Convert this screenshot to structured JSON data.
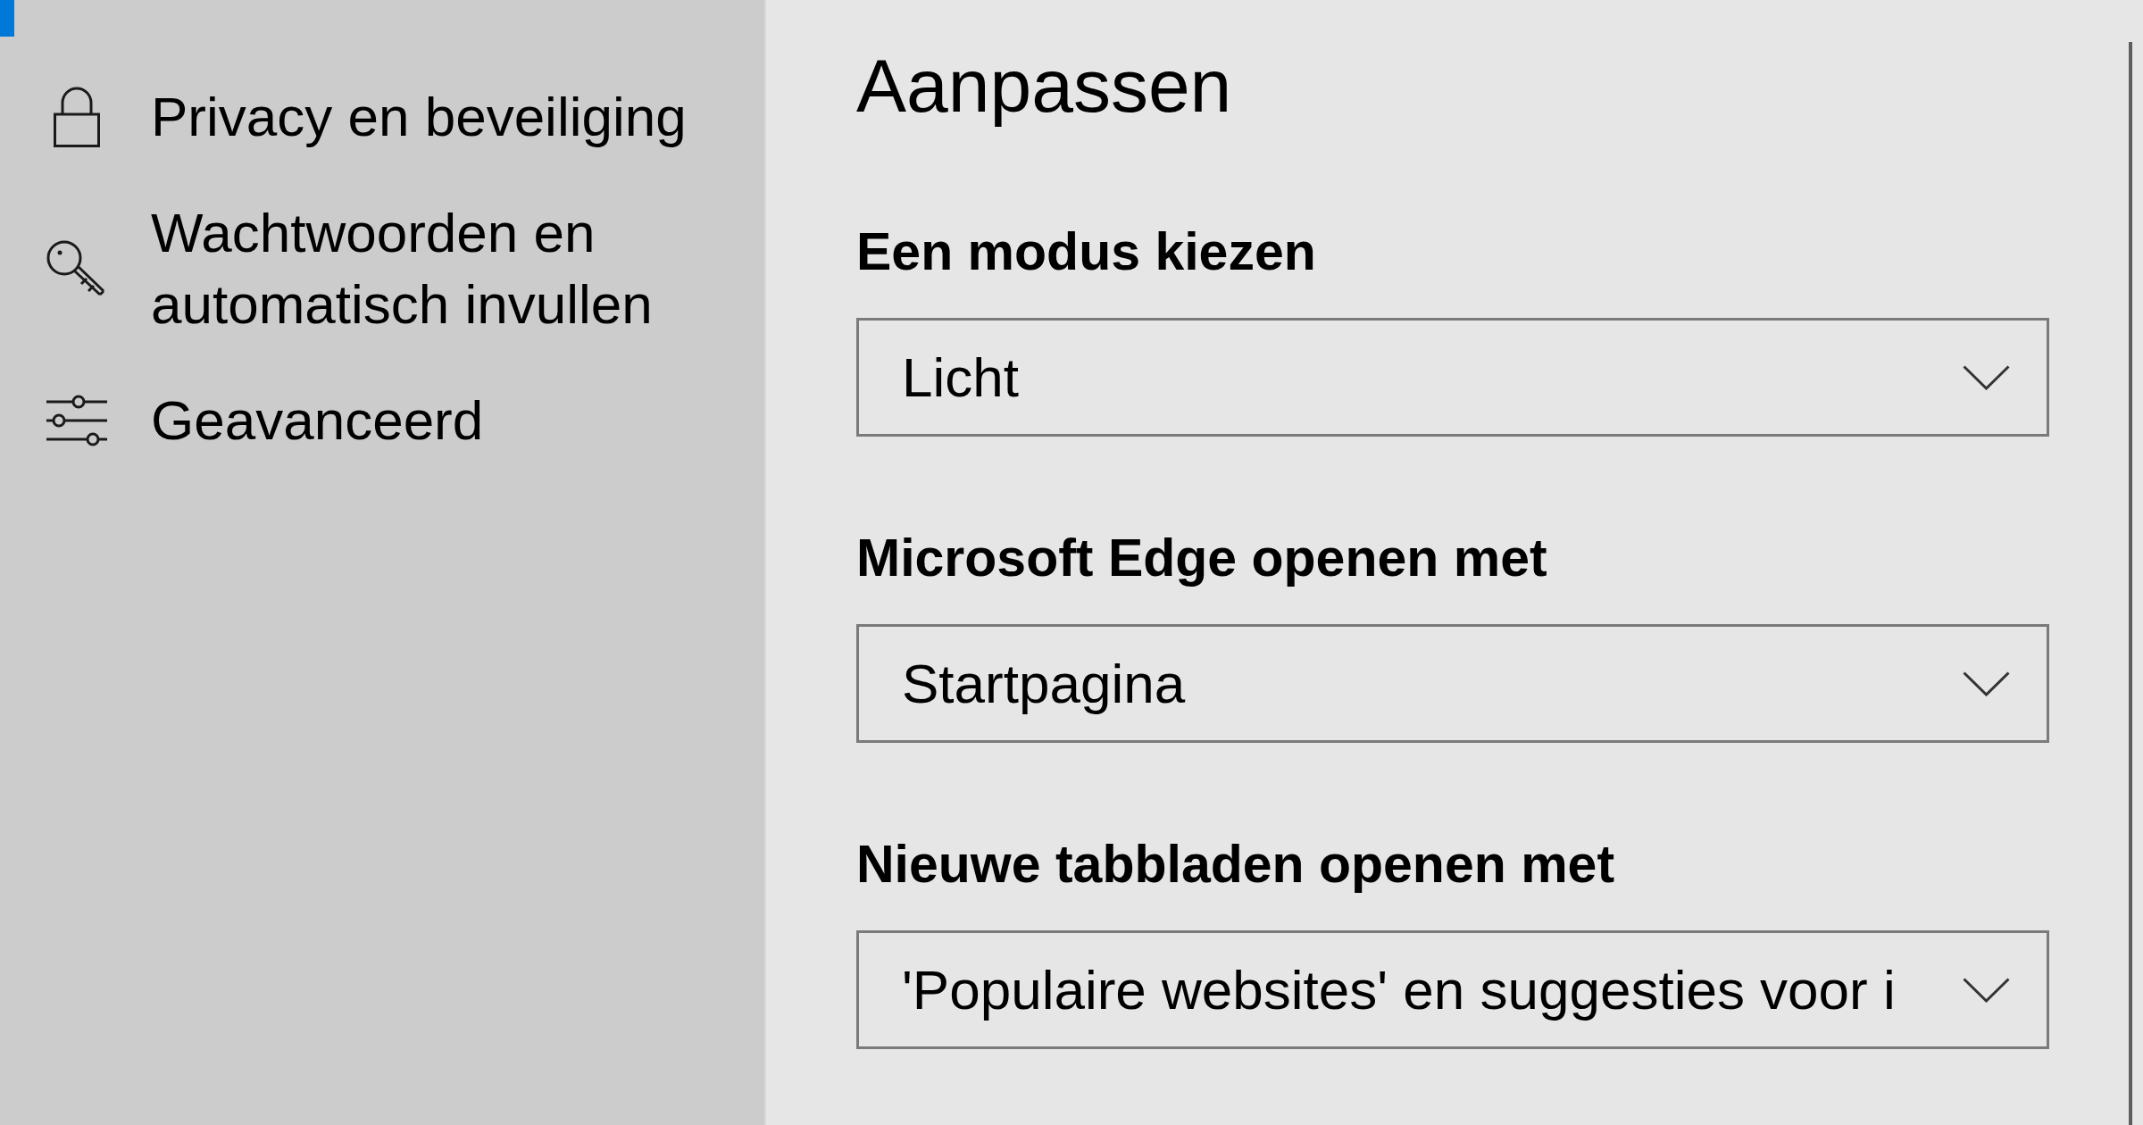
{
  "sidebar": {
    "items": [
      {
        "kind": "privacy",
        "label": "Privacy en beveiliging",
        "selected": false
      },
      {
        "kind": "passwords",
        "label": "Wachtwoorden en automatisch invullen",
        "selected": false
      },
      {
        "kind": "advanced",
        "label": "Geavanceerd",
        "selected": false
      }
    ]
  },
  "panel": {
    "title": "Aanpassen",
    "settings": [
      {
        "label": "Een modus kiezen",
        "dropdown": {
          "value": "Licht"
        }
      },
      {
        "label": "Microsoft Edge openen met",
        "dropdown": {
          "value": "Startpagina"
        }
      },
      {
        "label": "Nieuwe tabbladen openen met",
        "dropdown": {
          "value": "'Populaire websites' en suggesties voor i"
        }
      }
    ]
  }
}
